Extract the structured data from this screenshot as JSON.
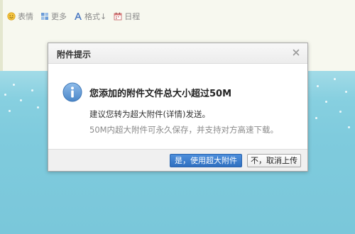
{
  "toolbar": {
    "items": [
      {
        "label": "表情",
        "icon": "smiley-icon"
      },
      {
        "label": "更多",
        "icon": "grid-icon"
      },
      {
        "label": "格式↓",
        "icon": "font-format-icon"
      },
      {
        "label": "日程",
        "icon": "calendar-icon"
      }
    ]
  },
  "dialog": {
    "title": "附件提示",
    "close_icon": "close-icon",
    "info_icon": "info-icon",
    "message": "您添加的附件文件总大小超过50M",
    "suggestion": "建议您转为超大附件(详情)发送。",
    "note": "50M内超大附件可永久保存，并支持对方高速下载。",
    "primary_button": "是，使用超大附件",
    "secondary_button": "不，取消上传"
  },
  "colors": {
    "accent": "#2f6fc0",
    "info_icon": "#5b9bd5",
    "background_sky": "#7fcbdd",
    "editor_background": "#f7f8ef"
  }
}
